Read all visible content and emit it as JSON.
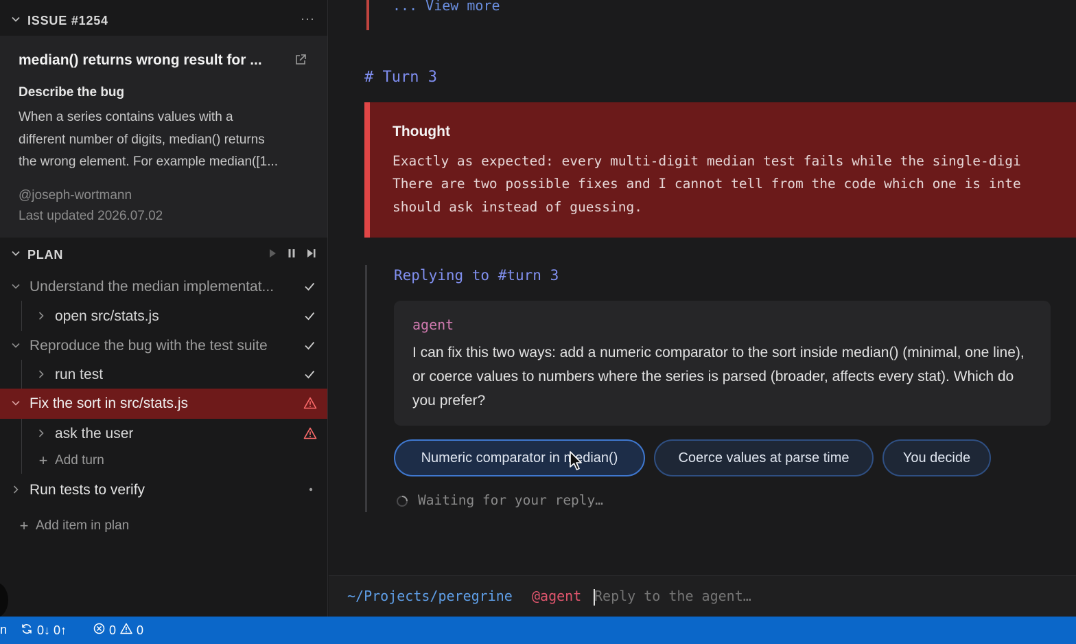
{
  "sidebar": {
    "issue_section": {
      "title": "ISSUE #1254",
      "more": "···"
    },
    "issue": {
      "title": "median() returns wrong result for ...",
      "subtitle": "Describe the bug",
      "body_lines": [
        "When a series contains values with a",
        "different number of digits, median() returns",
        "the wrong element. For example median([1..."
      ],
      "author": "@joseph-wortmann",
      "updated": "Last updated 2026.07.02"
    },
    "plan_section": {
      "title": "PLAN"
    },
    "plan": [
      {
        "label": "Understand the median implementat...",
        "status": "done"
      },
      {
        "label": "open src/stats.js",
        "status": "done"
      },
      {
        "label": "Reproduce the bug with the test suite",
        "status": "done"
      },
      {
        "label": "run test",
        "status": "done"
      },
      {
        "label": "Fix the sort in src/stats.js",
        "status": "warning"
      },
      {
        "label": "ask the user",
        "status": "warning"
      },
      {
        "label": "Add turn"
      },
      {
        "label": "Run tests to verify",
        "status": "pending"
      },
      {
        "label": "Add item in plan"
      }
    ]
  },
  "main": {
    "view_more": "... View more",
    "turn_heading": "# Turn 3",
    "thought": {
      "title": "Thought",
      "lines": [
        "Exactly as expected: every multi-digit median test fails while the single-digi",
        "There are two possible fixes and I cannot tell from the code which one is inte",
        "should ask instead of guessing."
      ]
    },
    "reply_heading": "Replying to #turn 3",
    "agent": {
      "name": "agent",
      "message": "I can fix this two ways: add a numeric comparator to the sort inside median() (minimal, one line), or coerce values to numbers where the series is parsed (broader, affects every stat). Which do you prefer?"
    },
    "choices": [
      "Numeric comparator in median()",
      "Coerce values at parse time",
      "You decide"
    ],
    "waiting": "Waiting for your reply…",
    "prompt": {
      "path": "~/Projects/peregrine",
      "agent": "@agent",
      "placeholder": "Reply to the agent…"
    }
  },
  "statusbar": {
    "branch_fragment": "n",
    "sync": "0↓ 0↑",
    "errors": "0",
    "warnings": "0"
  },
  "colors": {
    "accent_blue": "#0b67c9",
    "thought_bg": "#6b1a1a",
    "thought_border": "#e04646",
    "active_row": "#6e1a1a"
  }
}
